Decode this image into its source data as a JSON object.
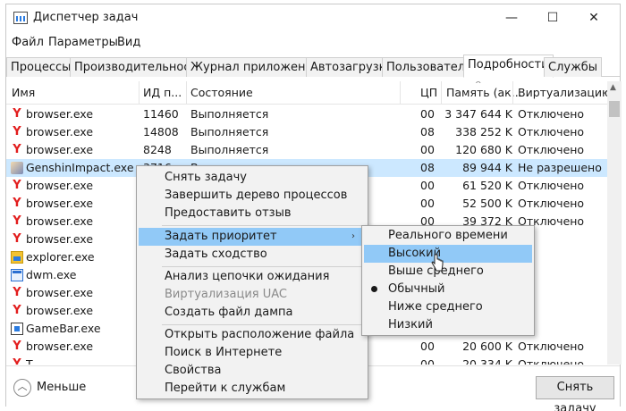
{
  "window": {
    "title": "Диспетчер задач",
    "controls": {
      "minimize": "—",
      "maximize": "☐",
      "close": "✕"
    }
  },
  "menu": [
    "Файл",
    "Параметры",
    "Вид"
  ],
  "tabs": [
    "Процессы",
    "Производительность",
    "Журнал приложений",
    "Автозагрузка",
    "Пользователи",
    "Подробности",
    "Службы"
  ],
  "active_tab": "Подробности",
  "table": {
    "columns": [
      "Имя",
      "ИД п...",
      "Состояние",
      "ЦП",
      "Память (ак...",
      "Виртуализацию"
    ],
    "sort_indicator": "^",
    "rows": [
      {
        "name": "browser.exe",
        "pid": "11460",
        "state": "Выполняется",
        "cpu": "00",
        "mem": "3 347 644 K",
        "virt": "Отключено",
        "icon": "yandex-browser-icon"
      },
      {
        "name": "browser.exe",
        "pid": "14808",
        "state": "Выполняется",
        "cpu": "08",
        "mem": "338 252 K",
        "virt": "Отключено",
        "icon": "yandex-browser-icon"
      },
      {
        "name": "browser.exe",
        "pid": "8248",
        "state": "Выполняется",
        "cpu": "00",
        "mem": "120 680 K",
        "virt": "Отключено",
        "icon": "yandex-browser-icon"
      },
      {
        "name": "GenshinImpact.exe",
        "pid": "3716",
        "state": "В...",
        "cpu": "08",
        "mem": "89 944 K",
        "virt": "Не разрешено",
        "icon": "genshin-icon",
        "selected": true
      },
      {
        "name": "browser.exe",
        "pid": "",
        "state": "",
        "cpu": "00",
        "mem": "61 520 K",
        "virt": "Отключено",
        "icon": "yandex-browser-icon"
      },
      {
        "name": "browser.exe",
        "pid": "",
        "state": "",
        "cpu": "00",
        "mem": "52 500 K",
        "virt": "Отключено",
        "icon": "yandex-browser-icon"
      },
      {
        "name": "browser.exe",
        "pid": "",
        "state": "",
        "cpu": "00",
        "mem": "39 372 K",
        "virt": "Отключено",
        "icon": "yandex-browser-icon"
      },
      {
        "name": "browser.exe",
        "pid": "",
        "state": "",
        "cpu": "",
        "mem": "",
        "virt": "",
        "icon": "yandex-browser-icon"
      },
      {
        "name": "explorer.exe",
        "pid": "",
        "state": "",
        "cpu": "",
        "mem": "",
        "virt": "",
        "icon": "explorer-icon"
      },
      {
        "name": "dwm.exe",
        "pid": "",
        "state": "",
        "cpu": "",
        "mem": "",
        "virt": "",
        "icon": "dwm-icon"
      },
      {
        "name": "browser.exe",
        "pid": "",
        "state": "",
        "cpu": "",
        "mem": "",
        "virt": "",
        "icon": "yandex-browser-icon"
      },
      {
        "name": "browser.exe",
        "pid": "",
        "state": "",
        "cpu": "",
        "mem": "",
        "virt": "",
        "icon": "yandex-browser-icon"
      },
      {
        "name": "GameBar.exe",
        "pid": "",
        "state": "",
        "cpu": "",
        "mem": "",
        "virt": "",
        "icon": "gamebar-icon"
      },
      {
        "name": "browser.exe",
        "pid": "",
        "state": "",
        "cpu": "00",
        "mem": "20 600 K",
        "virt": "Отключено",
        "icon": "yandex-browser-icon"
      },
      {
        "name": "T...",
        "pid": "",
        "state": "",
        "cpu": "00",
        "mem": "20 334 K",
        "virt": "Отключено",
        "icon": "yandex-browser-icon"
      }
    ]
  },
  "footer": {
    "less_label": "Меньше",
    "end_task_label": "Снять задачу"
  },
  "context_menu": {
    "items": [
      {
        "label": "Снять задачу"
      },
      {
        "label": "Завершить дерево процессов"
      },
      {
        "label": "Предоставить отзыв"
      },
      {
        "label": "Задать приоритет",
        "submenu": true,
        "highlighted": true
      },
      {
        "label": "Задать сходство"
      },
      {
        "label": "Анализ цепочки ожидания"
      },
      {
        "label": "Виртуализация UAC",
        "disabled": true
      },
      {
        "label": "Создать файл дампа"
      },
      {
        "label": "Открыть расположение файла"
      },
      {
        "label": "Поиск в Интернете"
      },
      {
        "label": "Свойства"
      },
      {
        "label": "Перейти к службам"
      }
    ],
    "submenu_arrow": "›"
  },
  "priority_submenu": {
    "items": [
      {
        "label": "Реального времени"
      },
      {
        "label": "Высокий",
        "highlighted": true
      },
      {
        "label": "Выше среднего"
      },
      {
        "label": "Обычный",
        "checked": true
      },
      {
        "label": "Ниже среднего"
      },
      {
        "label": "Низкий"
      }
    ]
  }
}
